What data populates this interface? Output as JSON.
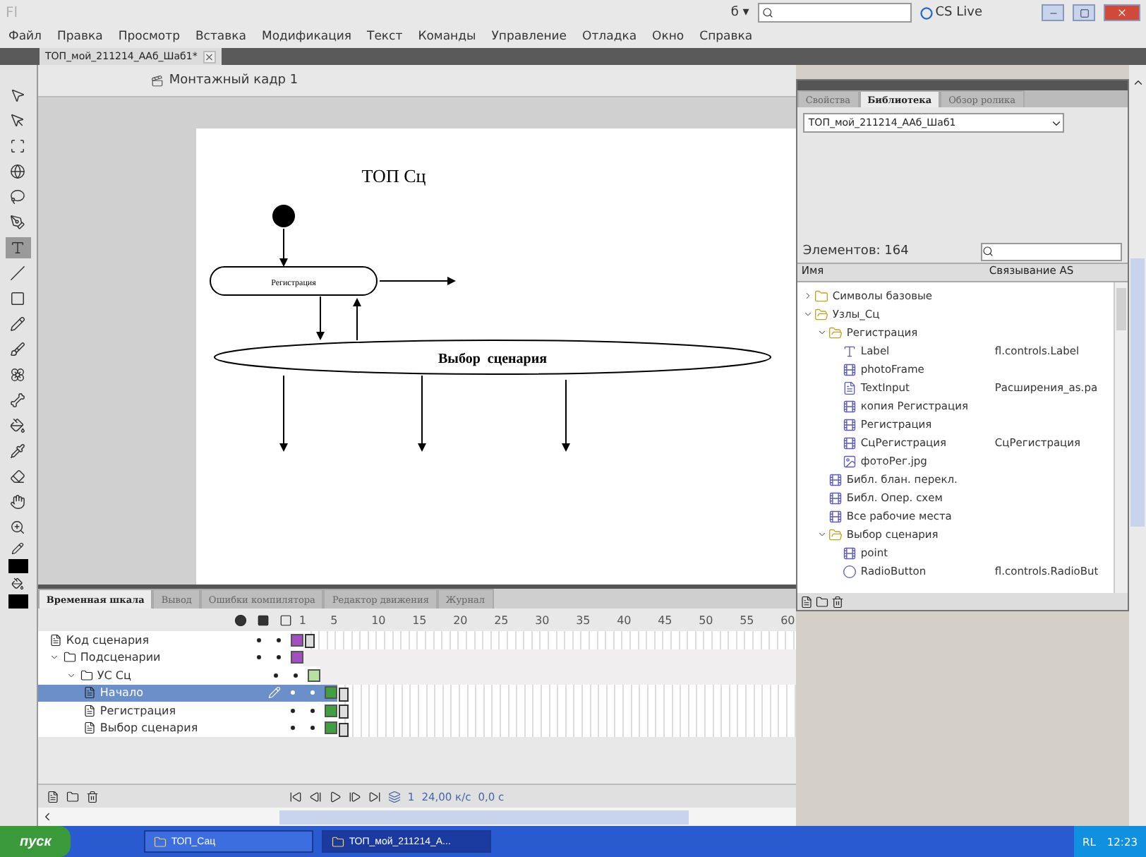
{
  "title_bar": {
    "app_logo": "Fl",
    "workspace": "б ▾",
    "cs_live": "CS Live"
  },
  "menu": [
    "Файл",
    "Правка",
    "Просмотр",
    "Вставка",
    "Модификация",
    "Текст",
    "Команды",
    "Управление",
    "Отладка",
    "Окно",
    "Справка"
  ],
  "document_tab": {
    "title": "ТОП_мой_211214_ААб_Шаб1*",
    "close": "×"
  },
  "edit_bar": {
    "scene": "Монтажный кадр 1"
  },
  "toolbar": {
    "tools": [
      {
        "kind": "select",
        "selected": false
      },
      {
        "kind": "subselect",
        "selected": false
      },
      {
        "kind": "transform",
        "selected": false
      },
      {
        "kind": "rotate3d",
        "selected": false
      },
      {
        "kind": "lasso",
        "selected": false
      },
      {
        "kind": "pen",
        "selected": false
      },
      {
        "kind": "text",
        "selected": true
      },
      {
        "kind": "line",
        "selected": false
      },
      {
        "kind": "rect",
        "selected": false
      },
      {
        "kind": "pencil",
        "selected": false
      },
      {
        "kind": "brush",
        "selected": false
      },
      {
        "kind": "deco",
        "selected": false
      },
      {
        "kind": "bone",
        "selected": false
      },
      {
        "kind": "bucket",
        "selected": false
      },
      {
        "kind": "eyedropper",
        "selected": false
      },
      {
        "kind": "eraser",
        "selected": false
      },
      {
        "kind": "hand",
        "selected": false
      },
      {
        "kind": "zoom",
        "selected": false
      }
    ]
  },
  "stage": {
    "title": "ТОП Сц",
    "nodes": [
      {
        "kind": "start"
      },
      {
        "kind": "small",
        "label": "Регистрация"
      },
      {
        "kind": "wide",
        "label": "Выбор  сценария"
      }
    ]
  },
  "library": {
    "tabs": [
      {
        "label": "Свойства",
        "selected": false
      },
      {
        "label": "Библиотека",
        "selected": true
      },
      {
        "label": "Обзор ролика",
        "selected": false
      }
    ],
    "document": "ТОП_мой_211214_ААб_Шаб1",
    "count": "Элементов: 164",
    "columns": [
      "Имя",
      "Связывание AS"
    ],
    "items": [
      {
        "kind": "folder",
        "name": "Символы базовые",
        "expanded": false
      },
      {
        "kind": "folder",
        "name": "Узлы_Сц",
        "expanded": true,
        "children": [
          {
            "kind": "folder",
            "name": "Регистрация",
            "expanded": true,
            "children": [
              {
                "kind": "text",
                "name": "Label",
                "linkage": "fl.controls.Label"
              },
              {
                "kind": "symbol",
                "name": "photoFrame"
              },
              {
                "kind": "component",
                "name": "TextInput",
                "linkage": "Расширения_as.ра"
              },
              {
                "kind": "symbol",
                "name": "копия Регистрация"
              },
              {
                "kind": "symbol",
                "name": "Регистрация"
              },
              {
                "kind": "symbol",
                "name": "СцРегистрация",
                "linkage": "СцРегистрация"
              },
              {
                "kind": "bitmap",
                "name": "фотоРег.jpg"
              }
            ]
          },
          {
            "kind": "symbol",
            "name": "Библ. блан. перекл."
          },
          {
            "kind": "symbol",
            "name": "Библ. Опер. схем"
          },
          {
            "kind": "symbol",
            "name": "Все рабочие места"
          },
          {
            "kind": "folder",
            "name": "Выбор сценария",
            "expanded": true,
            "children": [
              {
                "kind": "symbol",
                "name": "point"
              },
              {
                "kind": "radio",
                "name": "RadioButton",
                "linkage": "fl.controls.RadioBut"
              }
            ]
          }
        ]
      }
    ]
  },
  "timeline": {
    "tabs": [
      {
        "label": "Временная шкала",
        "selected": true
      },
      {
        "label": "Вывод",
        "selected": false
      },
      {
        "label": "Ошибки компилятора",
        "selected": false
      },
      {
        "label": "Редактор движения",
        "selected": false
      },
      {
        "label": "Журнал",
        "selected": false
      }
    ],
    "ruler": [
      "1",
      "5",
      "10",
      "15",
      "20",
      "25",
      "30",
      "35",
      "40",
      "45",
      "50",
      "55",
      "60"
    ],
    "layers": [
      {
        "kind": "layer",
        "name": "Код сценария",
        "selected": false,
        "color": "#a050c0"
      },
      {
        "kind": "folder",
        "name": "Подсценарии",
        "selected": false,
        "expanded": true,
        "color": "#a050c0",
        "children": [
          {
            "kind": "folder",
            "name": "УС Сц",
            "selected": false,
            "expanded": true,
            "color": "#b8e0a0",
            "children": [
              {
                "kind": "layer",
                "name": "Начало",
                "selected": true,
                "color": "#40a040"
              },
              {
                "kind": "layer",
                "name": "Регистрация",
                "selected": false,
                "color": "#40a040"
              },
              {
                "kind": "layer",
                "name": "Выбор сценария",
                "selected": false,
                "color": "#40a040"
              }
            ]
          }
        ]
      }
    ],
    "current_frame": "1",
    "frame_rate": "24,00 к/с",
    "time": "0,0 с"
  },
  "taskbar": {
    "start": "пуск",
    "tasks": [
      {
        "label": "ТОП_Сац",
        "selected": false
      },
      {
        "label": "ТОП_мой_211214_А...",
        "selected": true
      }
    ],
    "language": "RL",
    "clock": "12:23"
  }
}
